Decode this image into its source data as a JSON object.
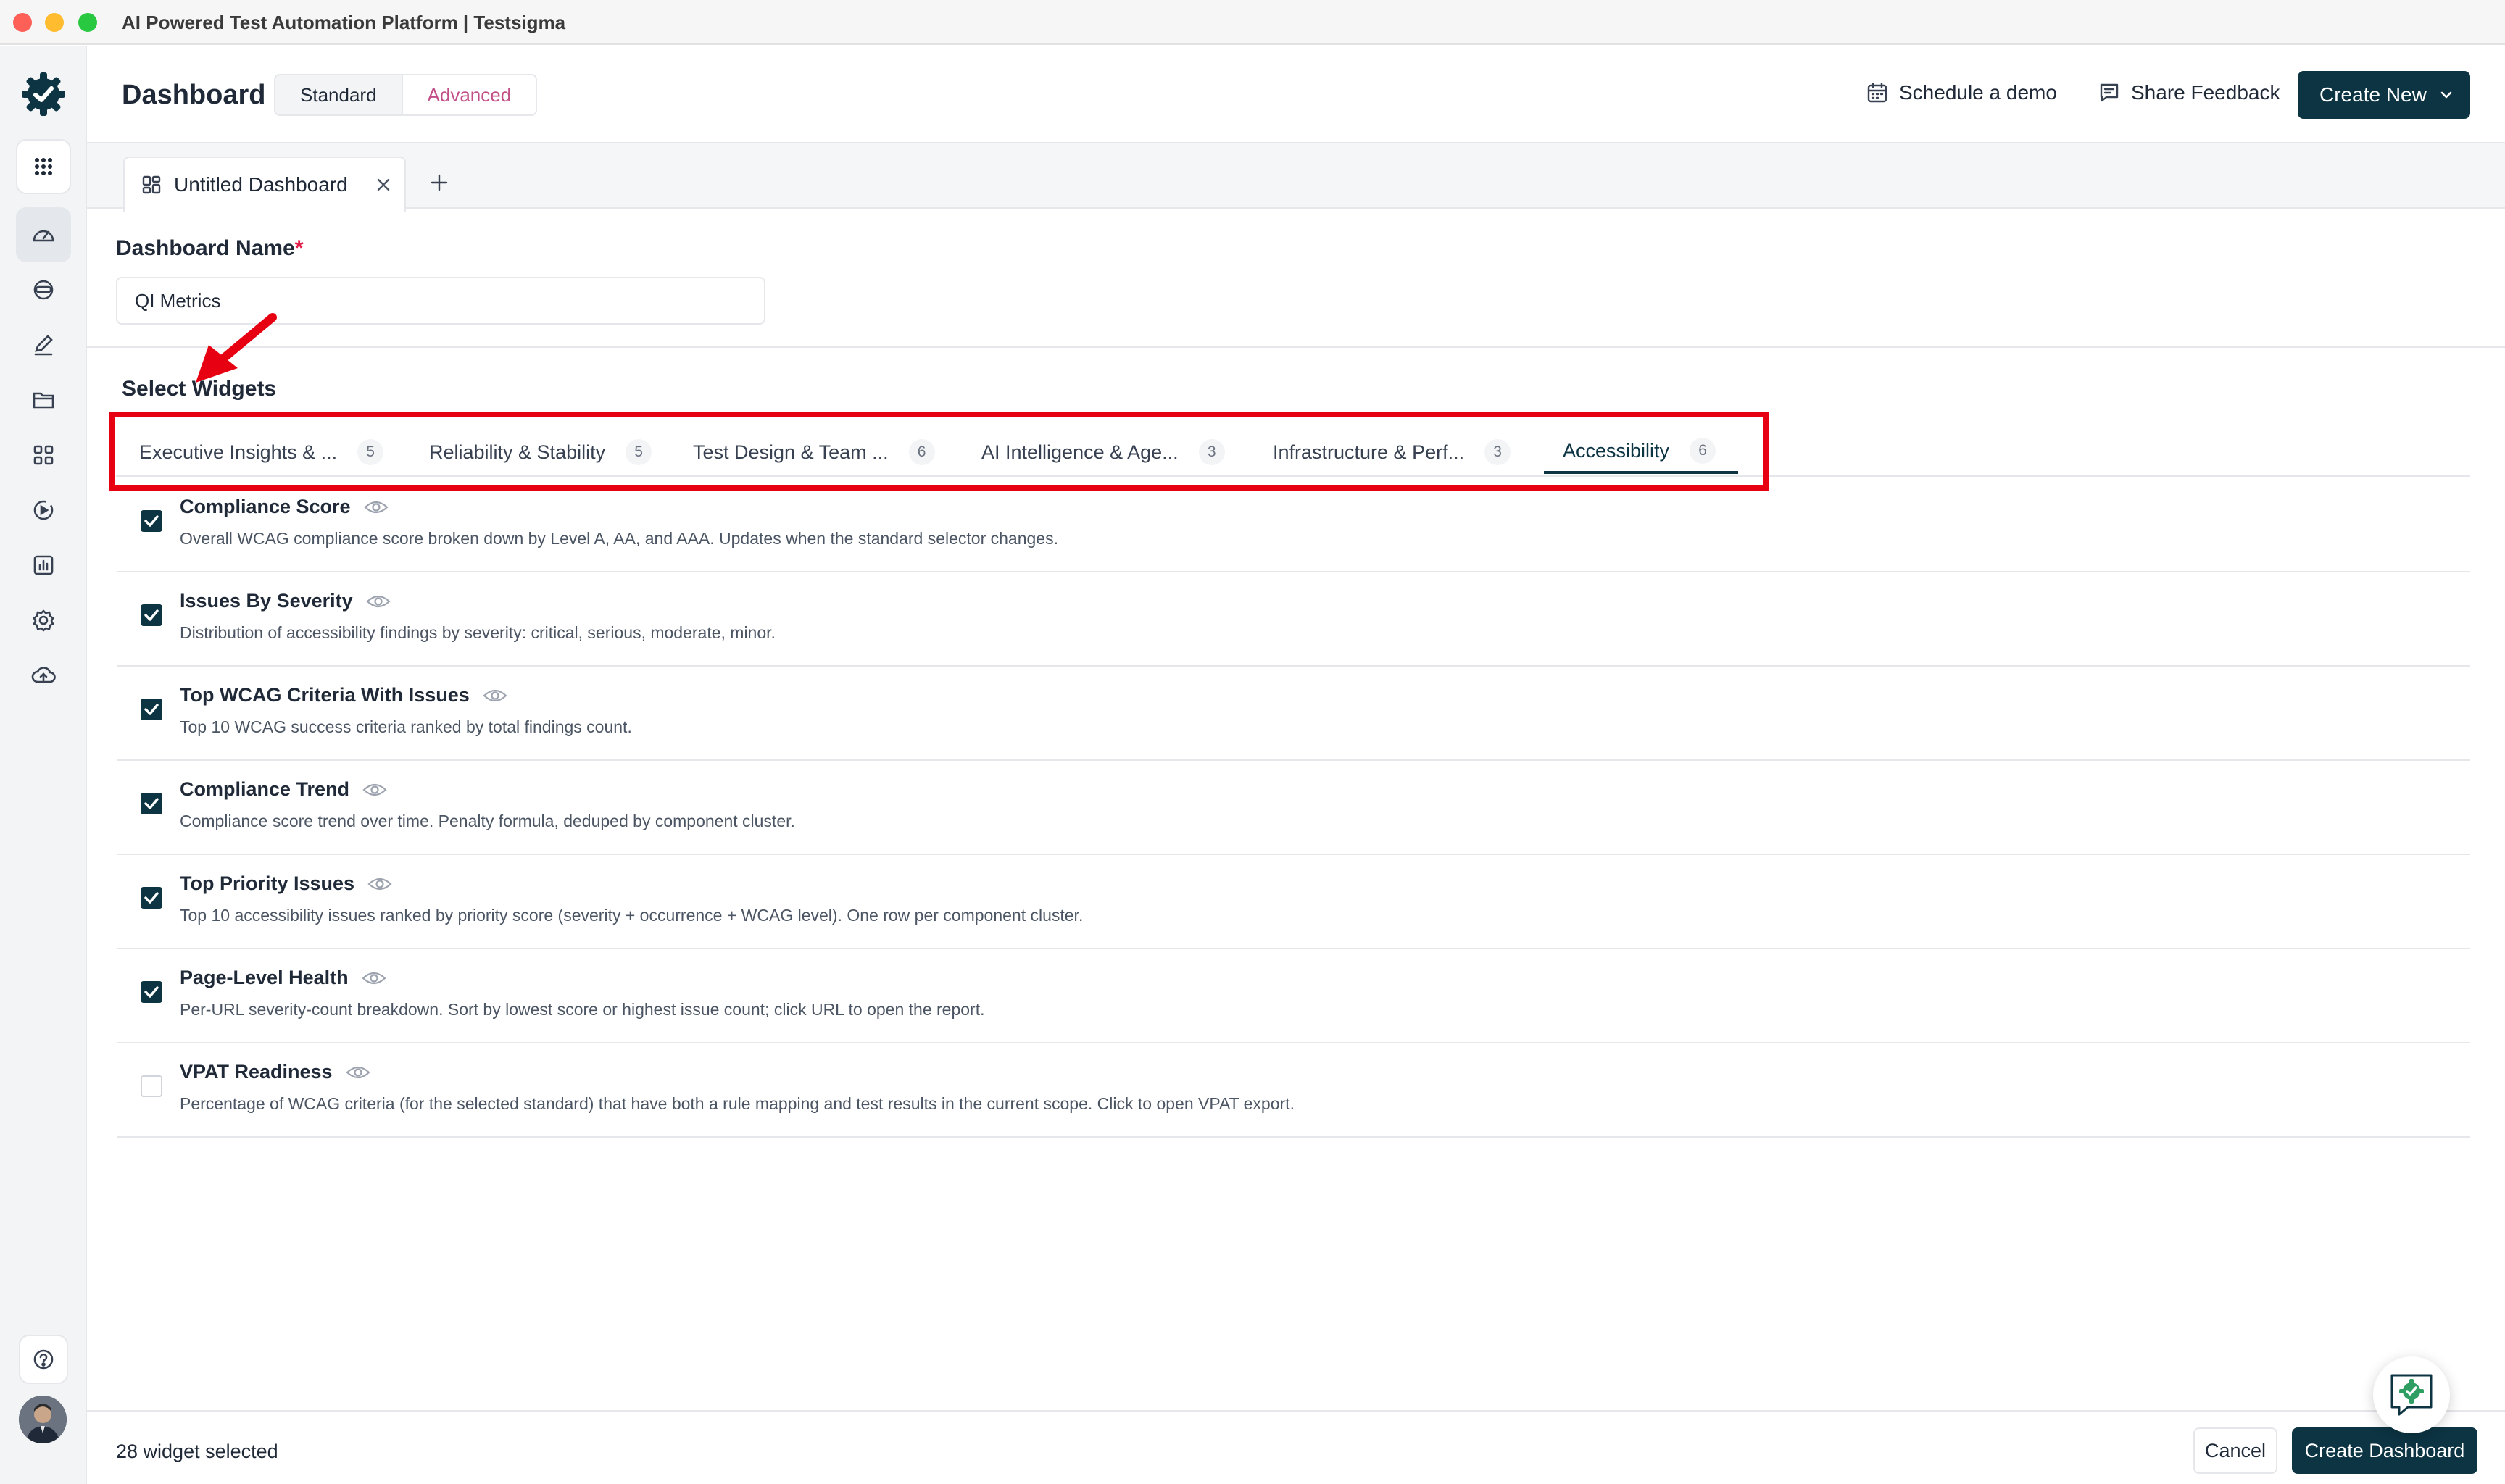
{
  "window": {
    "title": "AI Powered Test Automation Platform | Testsigma"
  },
  "header": {
    "title": "Dashboard",
    "modes": [
      "Standard",
      "Advanced"
    ],
    "selected_mode": "Advanced",
    "schedule_demo": "Schedule a demo",
    "share_feedback": "Share Feedback",
    "create_new": "Create New"
  },
  "dashboard_tabs": [
    {
      "label": "Untitled Dashboard"
    }
  ],
  "form": {
    "name_label": "Dashboard Name",
    "required_mark": "*",
    "name_value": "QI Metrics"
  },
  "widgets_section": {
    "title": "Select Widgets",
    "categories": [
      {
        "label": "Executive Insights & ...",
        "count": "5"
      },
      {
        "label": "Reliability & Stability",
        "count": "5"
      },
      {
        "label": "Test Design & Team ...",
        "count": "6"
      },
      {
        "label": "AI Intelligence & Age...",
        "count": "3"
      },
      {
        "label": "Infrastructure & Perf...",
        "count": "3"
      },
      {
        "label": "Accessibility",
        "count": "6"
      }
    ],
    "active_category": "Accessibility",
    "items": [
      {
        "title": "Compliance Score",
        "desc": "Overall WCAG compliance score broken down by Level A, AA, and AAA. Updates when the standard selector changes.",
        "checked": true
      },
      {
        "title": "Issues By Severity",
        "desc": "Distribution of accessibility findings by severity: critical, serious, moderate, minor.",
        "checked": true
      },
      {
        "title": "Top WCAG Criteria With Issues",
        "desc": "Top 10 WCAG success criteria ranked by total findings count.",
        "checked": true
      },
      {
        "title": "Compliance Trend",
        "desc": "Compliance score trend over time. Penalty formula, deduped by component cluster.",
        "checked": true
      },
      {
        "title": "Top Priority Issues",
        "desc": "Top 10 accessibility issues ranked by priority score (severity + occurrence + WCAG level). One row per component cluster.",
        "checked": true
      },
      {
        "title": "Page-Level Health",
        "desc": "Per-URL severity-count breakdown. Sort by lowest score or highest issue count; click URL to open the report.",
        "checked": true
      },
      {
        "title": "VPAT Readiness",
        "desc": "Percentage of WCAG criteria (for the selected standard) that have both a rule mapping and test results in the current scope. Click to open VPAT export.",
        "checked": false
      }
    ]
  },
  "footer": {
    "selected_count": "28 widget selected",
    "cancel": "Cancel",
    "create": "Create Dashboard"
  },
  "colors": {
    "primary": "#0c3443",
    "accent_pink": "#c14f87",
    "annotation_red": "#e60012"
  }
}
